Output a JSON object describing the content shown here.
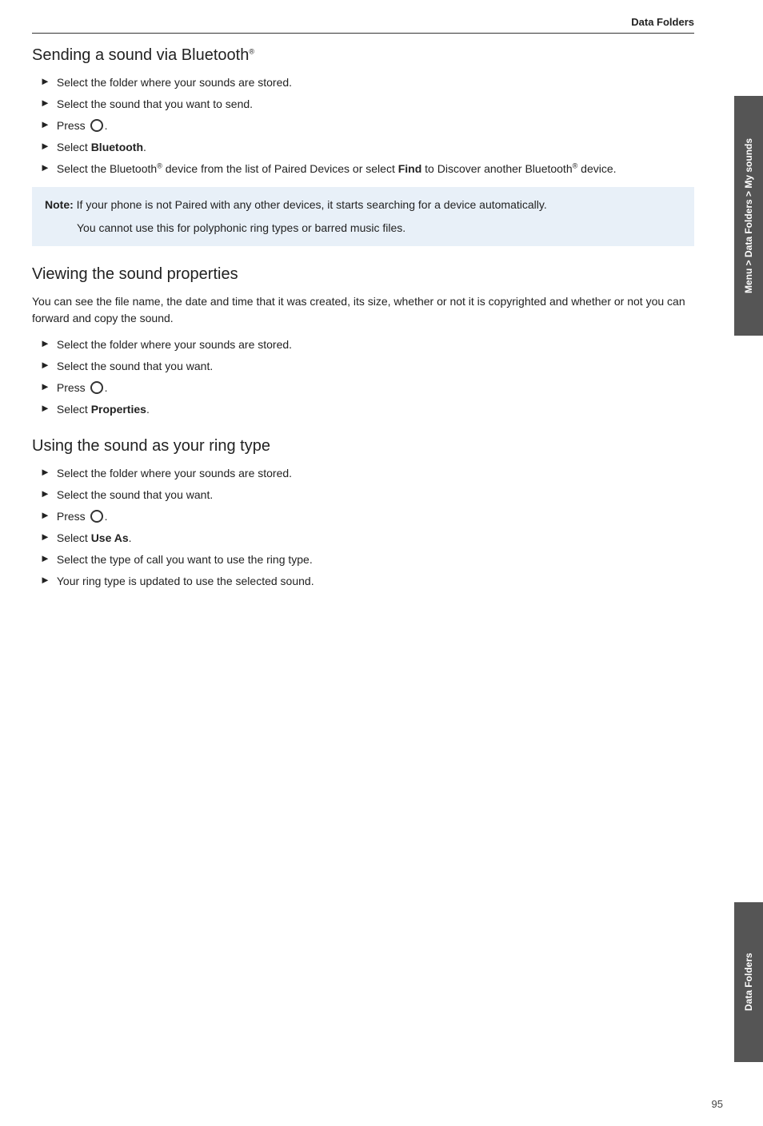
{
  "header": {
    "title": "Data Folders"
  },
  "side_tab_top": {
    "text": "Menu > Data Folders > My sounds"
  },
  "side_tab_bottom": {
    "text": "Data Folders"
  },
  "page_number": "95",
  "sections": [
    {
      "id": "sending",
      "heading": "Sending a sound via Bluetooth®",
      "steps": [
        {
          "text": "Select the folder where your sounds are stored."
        },
        {
          "text": "Select the sound that you want to send."
        },
        {
          "text": "Press",
          "has_icon": true
        },
        {
          "text": "Select Bluetooth.",
          "bold_part": "Bluetooth"
        },
        {
          "text": "Select the Bluetooth® device from the list of Paired Devices or select Find to Discover another Bluetooth® device.",
          "find_bold": true
        }
      ],
      "note": {
        "title": "Note:",
        "main": "If your phone is not Paired with any other devices, it starts searching for a device automatically.",
        "sub": "You cannot use this for polyphonic ring types or barred music files."
      }
    },
    {
      "id": "viewing",
      "heading": "Viewing the sound properties",
      "intro": "You can see the file name, the date and time that it was created, its size, whether or not it is copyrighted and whether or not you can forward and copy the sound.",
      "steps": [
        {
          "text": "Select the folder where your sounds are stored."
        },
        {
          "text": "Select the sound that you want."
        },
        {
          "text": "Press",
          "has_icon": true
        },
        {
          "text": "Select Properties.",
          "bold_part": "Properties"
        }
      ]
    },
    {
      "id": "using",
      "heading": "Using the sound as your ring type",
      "steps": [
        {
          "text": "Select the folder where your sounds are stored."
        },
        {
          "text": "Select the sound that you want."
        },
        {
          "text": "Press",
          "has_icon": true
        },
        {
          "text": "Select Use As.",
          "bold_part": "Use As"
        },
        {
          "text": "Select the type of call you want to use the ring type."
        },
        {
          "text": "Your ring type is updated to use the selected sound."
        }
      ]
    }
  ]
}
